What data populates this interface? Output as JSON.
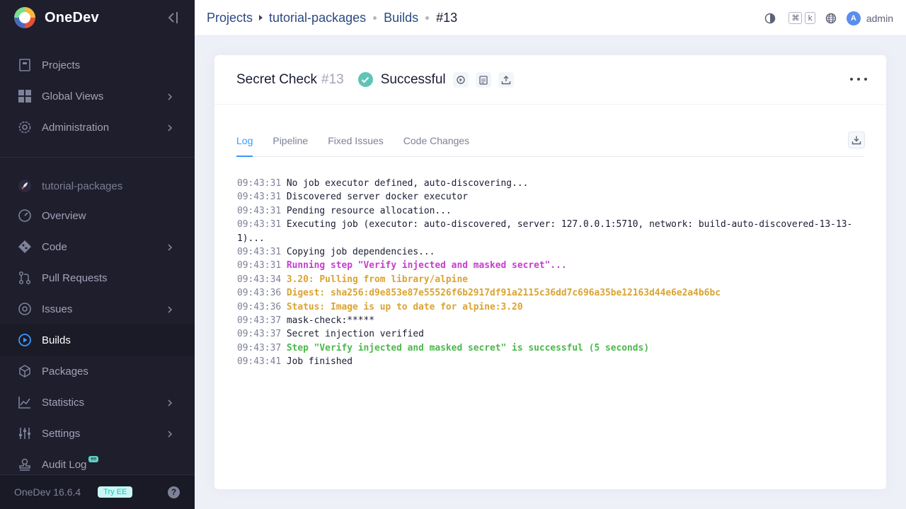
{
  "brand": {
    "name": "OneDev"
  },
  "sidebar": {
    "top_items": [
      {
        "label": "Projects",
        "icon": "projects-icon"
      },
      {
        "label": "Global Views",
        "icon": "global-views-icon"
      },
      {
        "label": "Administration",
        "icon": "administration-icon"
      }
    ],
    "project_name": "tutorial-packages",
    "project_items": [
      {
        "label": "Overview"
      },
      {
        "label": "Code"
      },
      {
        "label": "Pull Requests"
      },
      {
        "label": "Issues"
      },
      {
        "label": "Builds"
      },
      {
        "label": "Packages"
      },
      {
        "label": "Statistics"
      },
      {
        "label": "Settings"
      },
      {
        "label": "Audit Log"
      }
    ],
    "audit_badge": "ee",
    "footer": {
      "version": "OneDev 16.6.4",
      "try_ee": "Try EE",
      "help": "?"
    }
  },
  "header": {
    "breadcrumbs": [
      "Projects",
      "tutorial-packages",
      "Builds",
      "#13"
    ],
    "kbd": [
      "⌘",
      "k"
    ],
    "avatar_letter": "A",
    "user": "admin"
  },
  "build": {
    "job_name": "Secret Check",
    "number": "#13",
    "status": "Successful",
    "status_color": "#5ec5b6"
  },
  "tabs": [
    "Log",
    "Pipeline",
    "Fixed Issues",
    "Code Changes"
  ],
  "log": [
    {
      "ts": "09:43:31",
      "msg": "No job executor defined, auto-discovering...",
      "style": "normal"
    },
    {
      "ts": "09:43:31",
      "msg": "Discovered server docker executor",
      "style": "normal"
    },
    {
      "ts": "09:43:31",
      "msg": "Pending resource allocation...",
      "style": "normal"
    },
    {
      "ts": "09:43:31",
      "msg": "Executing job (executor: auto-discovered, server: 127.0.0.1:5710, network: build-auto-discovered-13-13-1)...",
      "style": "normal"
    },
    {
      "ts": "09:43:31",
      "msg": "Copying job dependencies...",
      "style": "normal"
    },
    {
      "ts": "09:43:31",
      "msg": "Running step \"Verify injected and masked secret\"...",
      "style": "step"
    },
    {
      "ts": "09:43:34",
      "msg": "3.20: Pulling from library/alpine",
      "style": "warn"
    },
    {
      "ts": "09:43:36",
      "msg": "Digest: sha256:d9e853e87e55526f6b2917df91a2115c36dd7c696a35be12163d44e6e2a4b6bc",
      "style": "warn"
    },
    {
      "ts": "09:43:36",
      "msg": "Status: Image is up to date for alpine:3.20",
      "style": "warn"
    },
    {
      "ts": "09:43:37",
      "msg": "mask-check:*****",
      "style": "normal"
    },
    {
      "ts": "09:43:37",
      "msg": "Secret injection verified",
      "style": "normal"
    },
    {
      "ts": "09:43:37",
      "msg": "Step \"Verify injected and masked secret\" is successful (5 seconds)",
      "style": "ok"
    },
    {
      "ts": "09:43:41",
      "msg": "Job finished",
      "style": "normal"
    }
  ]
}
